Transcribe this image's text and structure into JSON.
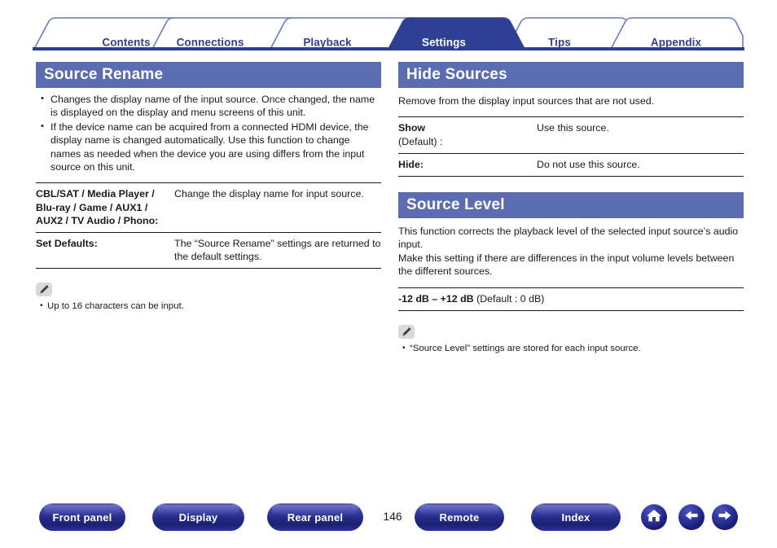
{
  "tabs": [
    {
      "label": "Contents",
      "active": false
    },
    {
      "label": "Connections",
      "active": false
    },
    {
      "label": "Playback",
      "active": false
    },
    {
      "label": "Settings",
      "active": true
    },
    {
      "label": "Tips",
      "active": false
    },
    {
      "label": "Appendix",
      "active": false
    }
  ],
  "colors": {
    "tab_text": "#2f3f93",
    "tab_active_bg": "#2f3f93",
    "banner_bg": "#5b6cb0",
    "rule": "#1a1a1a",
    "button_blue": "#232a86"
  },
  "left_column": {
    "section_title": "Source Rename",
    "bullets": [
      "Changes the display name of the input source. Once changed, the name is displayed on the display and menu screens of this unit.",
      "If the device name can be acquired from a connected HDMI device, the display name is changed automatically. Use this function to change names as needed when the device you are using differs from the input source on this unit."
    ],
    "table": [
      {
        "term": "CBL/SAT / Media Player / Blu-ray / Game / AUX1 / AUX2 / TV Audio / Phono:",
        "desc": "Change the display name for input source."
      },
      {
        "term": "Set Defaults:",
        "desc": "The “Source Rename” settings are returned to the default settings."
      }
    ],
    "note": {
      "icon": "pencil-note-icon",
      "items": [
        "Up to 16 characters can be input."
      ]
    }
  },
  "right_column": {
    "hide_sources": {
      "section_title": "Hide Sources",
      "intro": "Remove from the display input sources that are not used.",
      "table": [
        {
          "term": "Show",
          "term_sub": "(Default) :",
          "desc": "Use this source."
        },
        {
          "term": "Hide:",
          "term_sub": "",
          "desc": "Do not use this source."
        }
      ]
    },
    "source_level": {
      "section_title": "Source Level",
      "paragraphs": [
        "This function corrects the playback level of the selected input source’s audio input.",
        "Make this setting if there are differences in the input volume levels between the different sources."
      ],
      "range_bold": "-12 dB – +12 dB",
      "range_default": " (Default : 0 dB)",
      "note": {
        "icon": "pencil-note-icon",
        "items": [
          "“Source Level” settings are stored for each input source."
        ]
      }
    }
  },
  "footer": {
    "buttons": [
      {
        "label": "Front panel"
      },
      {
        "label": "Display"
      },
      {
        "label": "Rear panel"
      },
      {
        "label": "Remote"
      },
      {
        "label": "Index"
      }
    ],
    "page_number": "146",
    "icons": [
      {
        "name": "home-icon"
      },
      {
        "name": "arrow-left-icon"
      },
      {
        "name": "arrow-right-icon"
      }
    ]
  }
}
